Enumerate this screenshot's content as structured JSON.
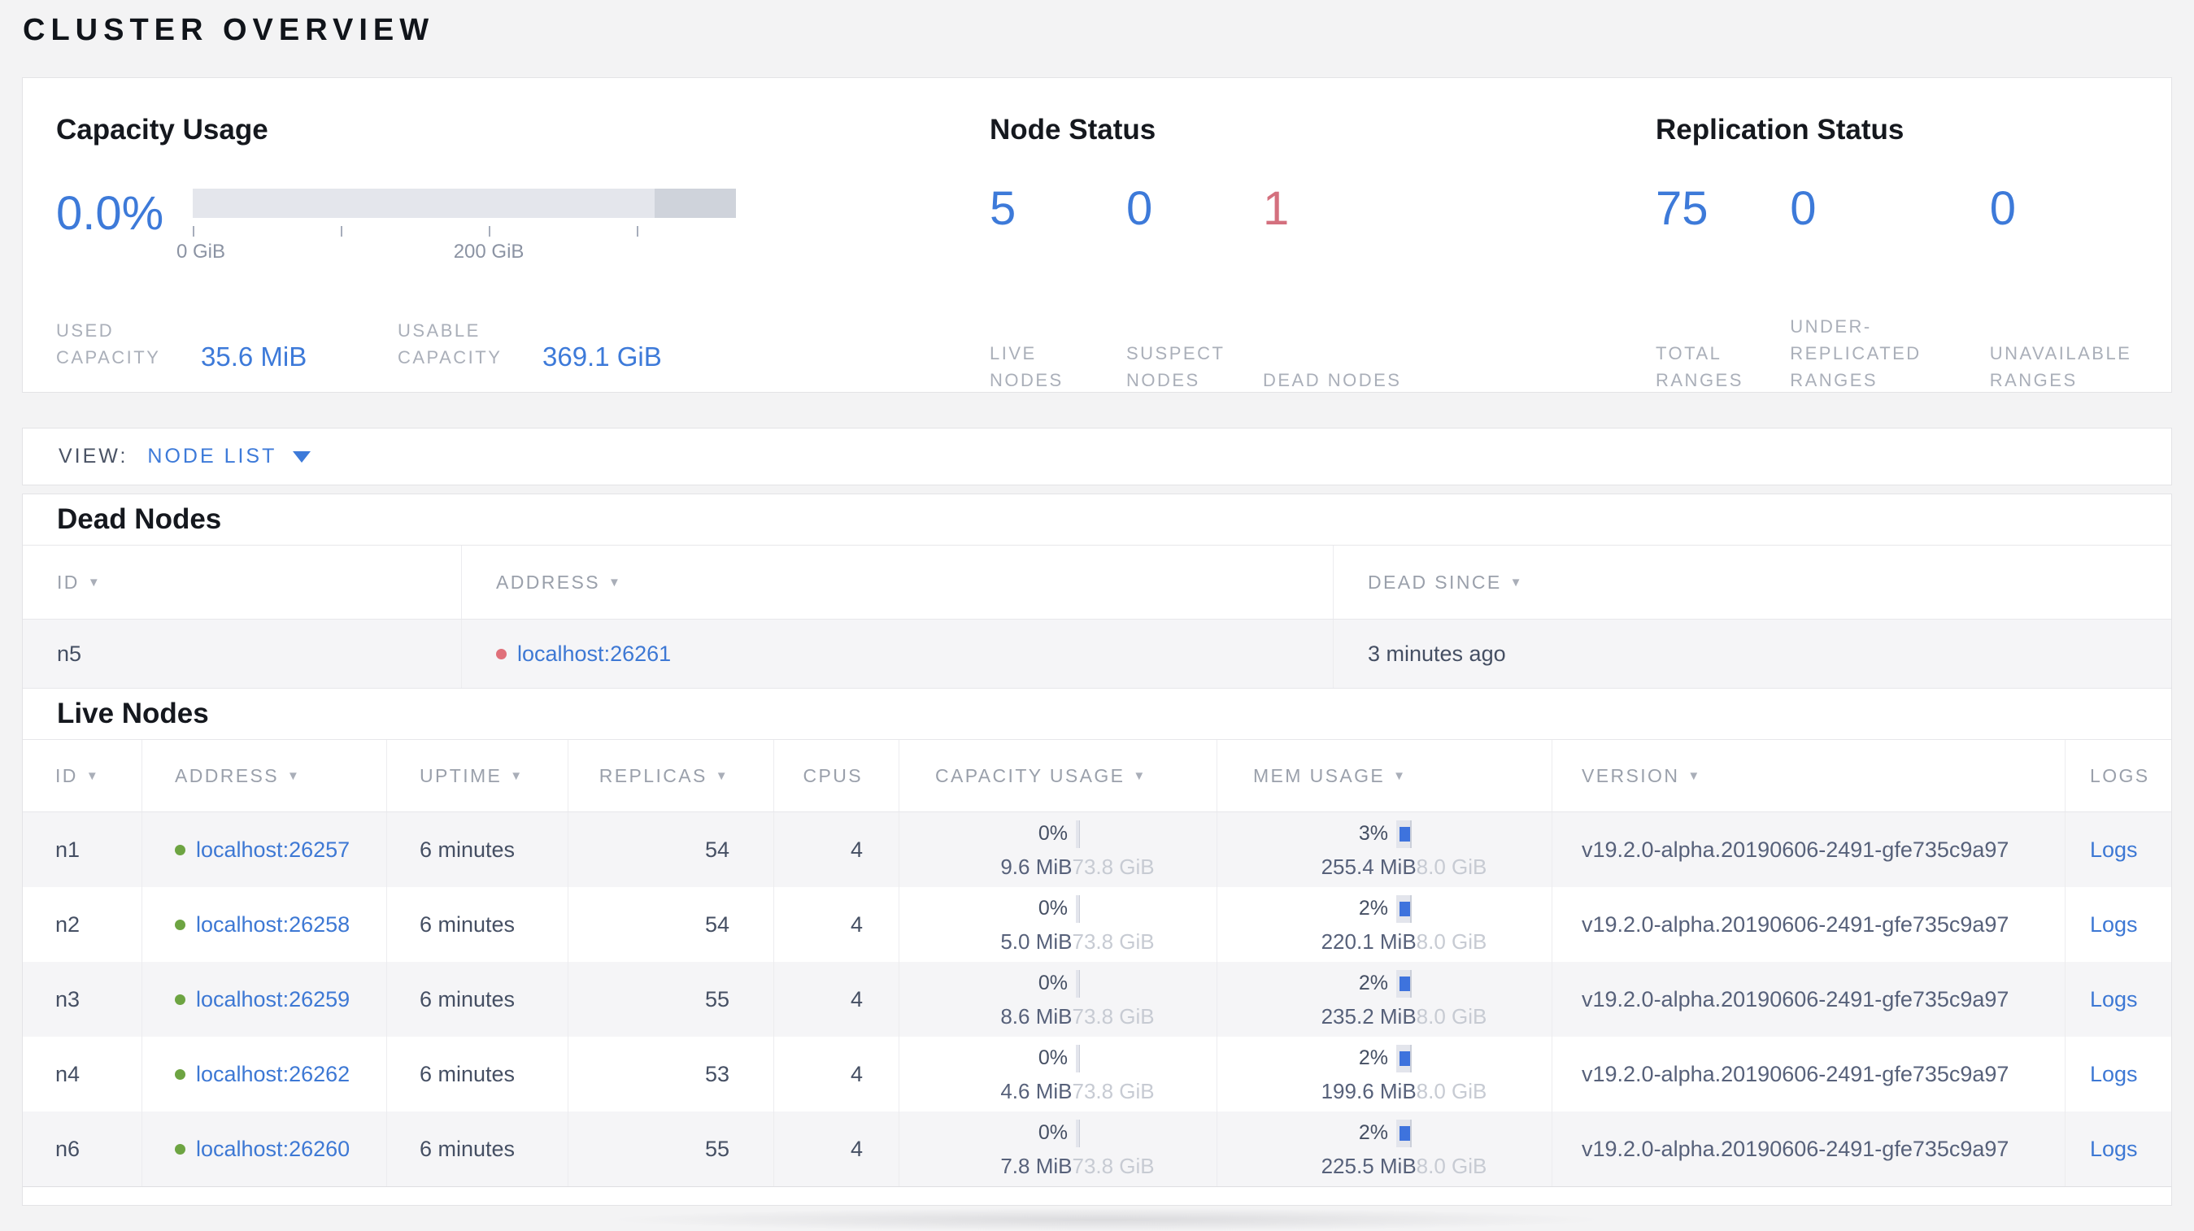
{
  "page": {
    "title": "CLUSTER OVERVIEW"
  },
  "colors": {
    "accent_blue": "#3d7ad9",
    "dead_red": "#d4707e",
    "live_green_dot": "#6da442",
    "dead_red_dot": "#e0707a",
    "bar_light": "#e4e6ec",
    "bar_dark": "#cfd3db"
  },
  "summary": {
    "capacity": {
      "title": "Capacity Usage",
      "percent": "0.0%",
      "used_fill_pct": 0,
      "ticks": [
        {
          "label": "0 GiB"
        },
        {
          "label": ""
        },
        {
          "label": "200 GiB"
        },
        {
          "label": ""
        }
      ],
      "stats": [
        {
          "label_line1": "USED",
          "label_line2": "CAPACITY",
          "value": "35.6 MiB"
        },
        {
          "label_line1": "USABLE",
          "label_line2": "CAPACITY",
          "value": "369.1 GiB"
        }
      ]
    },
    "node_status": {
      "title": "Node Status",
      "stats": [
        {
          "value": "5",
          "label": "LIVE NODES"
        },
        {
          "value": "0",
          "label": "SUSPECT NODES"
        },
        {
          "value": "1",
          "label": "DEAD NODES"
        }
      ]
    },
    "replication": {
      "title": "Replication Status",
      "stats": [
        {
          "value": "75",
          "label": "TOTAL RANGES"
        },
        {
          "value": "0",
          "label": "UNDER-REPLICATED RANGES"
        },
        {
          "value": "0",
          "label": "UNAVAILABLE RANGES"
        }
      ]
    }
  },
  "view_bar": {
    "label": "VIEW:",
    "selected": "NODE LIST"
  },
  "dead_nodes": {
    "heading": "Dead Nodes",
    "columns": [
      {
        "label": "ID"
      },
      {
        "label": "ADDRESS"
      },
      {
        "label": "DEAD SINCE"
      }
    ],
    "rows": [
      {
        "id": "n5",
        "address": "localhost:26261",
        "dead_since": "3 minutes ago"
      }
    ]
  },
  "live_nodes": {
    "heading": "Live Nodes",
    "columns": [
      {
        "label": "ID"
      },
      {
        "label": "ADDRESS"
      },
      {
        "label": "UPTIME"
      },
      {
        "label": "REPLICAS"
      },
      {
        "label": "CPUS"
      },
      {
        "label": "CAPACITY USAGE"
      },
      {
        "label": "MEM USAGE"
      },
      {
        "label": "VERSION"
      },
      {
        "label": "LOGS"
      }
    ],
    "rows": [
      {
        "id": "n1",
        "address": "localhost:26257",
        "uptime": "6 minutes",
        "replicas": "54",
        "cpus": "4",
        "capacity": {
          "pct": "0%",
          "fill_pct": 0,
          "used": "9.6 MiB",
          "total": "73.8 GiB"
        },
        "memory": {
          "pct": "3%",
          "fill_pct": 3,
          "used": "255.4 MiB",
          "total": "8.0 GiB"
        },
        "version": "v19.2.0-alpha.20190606-2491-gfe735c9a97",
        "logs_label": "Logs"
      },
      {
        "id": "n2",
        "address": "localhost:26258",
        "uptime": "6 minutes",
        "replicas": "54",
        "cpus": "4",
        "capacity": {
          "pct": "0%",
          "fill_pct": 0,
          "used": "5.0 MiB",
          "total": "73.8 GiB"
        },
        "memory": {
          "pct": "2%",
          "fill_pct": 2,
          "used": "220.1 MiB",
          "total": "8.0 GiB"
        },
        "version": "v19.2.0-alpha.20190606-2491-gfe735c9a97",
        "logs_label": "Logs"
      },
      {
        "id": "n3",
        "address": "localhost:26259",
        "uptime": "6 minutes",
        "replicas": "55",
        "cpus": "4",
        "capacity": {
          "pct": "0%",
          "fill_pct": 0,
          "used": "8.6 MiB",
          "total": "73.8 GiB"
        },
        "memory": {
          "pct": "2%",
          "fill_pct": 2,
          "used": "235.2 MiB",
          "total": "8.0 GiB"
        },
        "version": "v19.2.0-alpha.20190606-2491-gfe735c9a97",
        "logs_label": "Logs"
      },
      {
        "id": "n4",
        "address": "localhost:26262",
        "uptime": "6 minutes",
        "replicas": "53",
        "cpus": "4",
        "capacity": {
          "pct": "0%",
          "fill_pct": 0,
          "used": "4.6 MiB",
          "total": "73.8 GiB"
        },
        "memory": {
          "pct": "2%",
          "fill_pct": 2,
          "used": "199.6 MiB",
          "total": "8.0 GiB"
        },
        "version": "v19.2.0-alpha.20190606-2491-gfe735c9a97",
        "logs_label": "Logs"
      },
      {
        "id": "n6",
        "address": "localhost:26260",
        "uptime": "6 minutes",
        "replicas": "55",
        "cpus": "4",
        "capacity": {
          "pct": "0%",
          "fill_pct": 0,
          "used": "7.8 MiB",
          "total": "73.8 GiB"
        },
        "memory": {
          "pct": "2%",
          "fill_pct": 2,
          "used": "225.5 MiB",
          "total": "8.0 GiB"
        },
        "version": "v19.2.0-alpha.20190606-2491-gfe735c9a97",
        "logs_label": "Logs"
      }
    ]
  }
}
